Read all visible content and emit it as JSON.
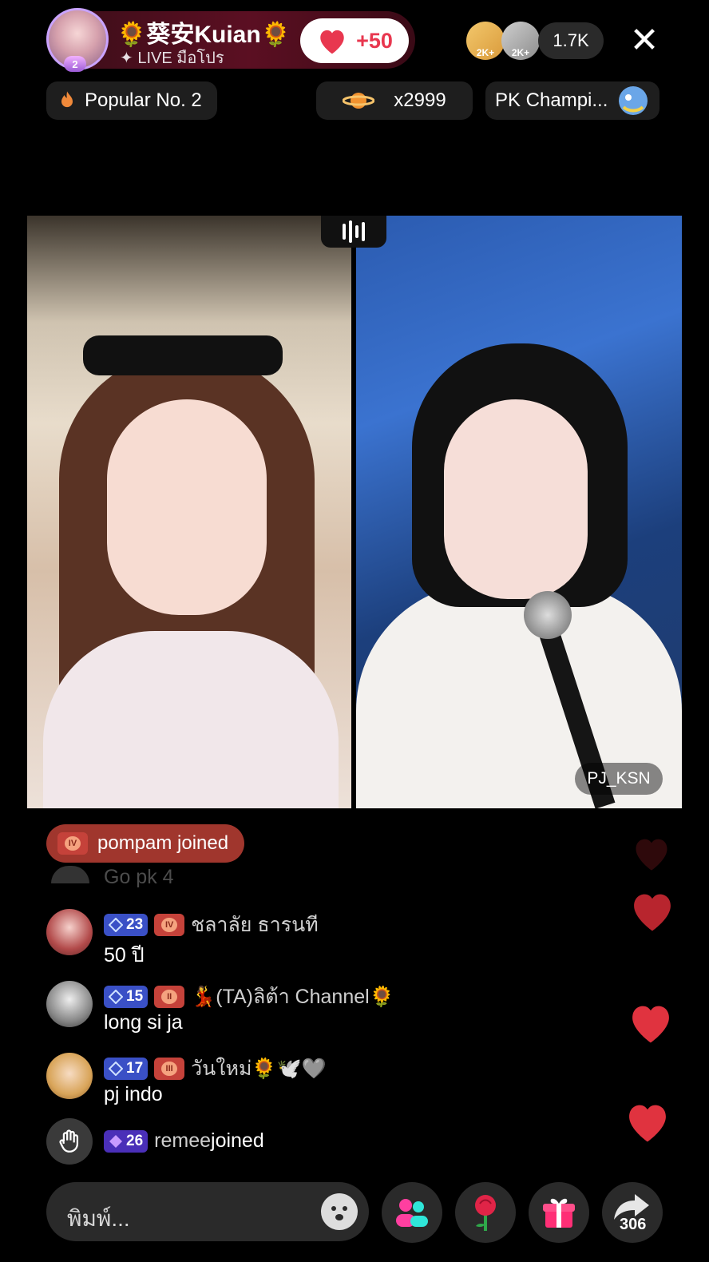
{
  "header": {
    "host_name": "🌻葵安Kuian🌻",
    "host_sub": "✦ LIVE มือโปร",
    "host_level": "2",
    "like_delta": "+50",
    "viewer_badges": [
      "2K+",
      "2K+"
    ],
    "viewer_count": "1.7K",
    "close_symbol": "✕"
  },
  "pills": {
    "popular": "Popular No. 2",
    "gift_count": "x2999",
    "pk_label": "PK Champi..."
  },
  "video": {
    "right_name": "PJ_KSN"
  },
  "chat": {
    "joined_banner": {
      "badge": "IV",
      "text": "pompam joined"
    },
    "faded_text": "Go pk 4",
    "messages": [
      {
        "level": "23",
        "fan": "IV",
        "user": "ชลาลัย ธารนที",
        "text": "50 ปี"
      },
      {
        "level": "15",
        "fan": "II",
        "user": "💃(TA)ลิต้า Channel🌻",
        "text": "long si ja"
      },
      {
        "level": "17",
        "fan": "III",
        "user": "วันใหม่🌻🕊️🩶",
        "text": "pj indo"
      }
    ],
    "join_event": {
      "level": "26",
      "user": "remee",
      "suffix": " joined"
    }
  },
  "bottom": {
    "input_placeholder": "พิมพ์...",
    "share_count": "306"
  },
  "colors": {
    "accent_red": "#e8374f",
    "level_blue": "#3a50c6",
    "fan_red": "#c5423a"
  },
  "icons": [
    "heart-icon",
    "close-icon",
    "flame-icon",
    "planet-icon",
    "dragon-icon",
    "sound-bars-icon",
    "diamond-icon",
    "wave-hand-icon",
    "emoji-icon",
    "multi-guest-icon",
    "rose-icon",
    "gift-icon",
    "share-icon"
  ]
}
